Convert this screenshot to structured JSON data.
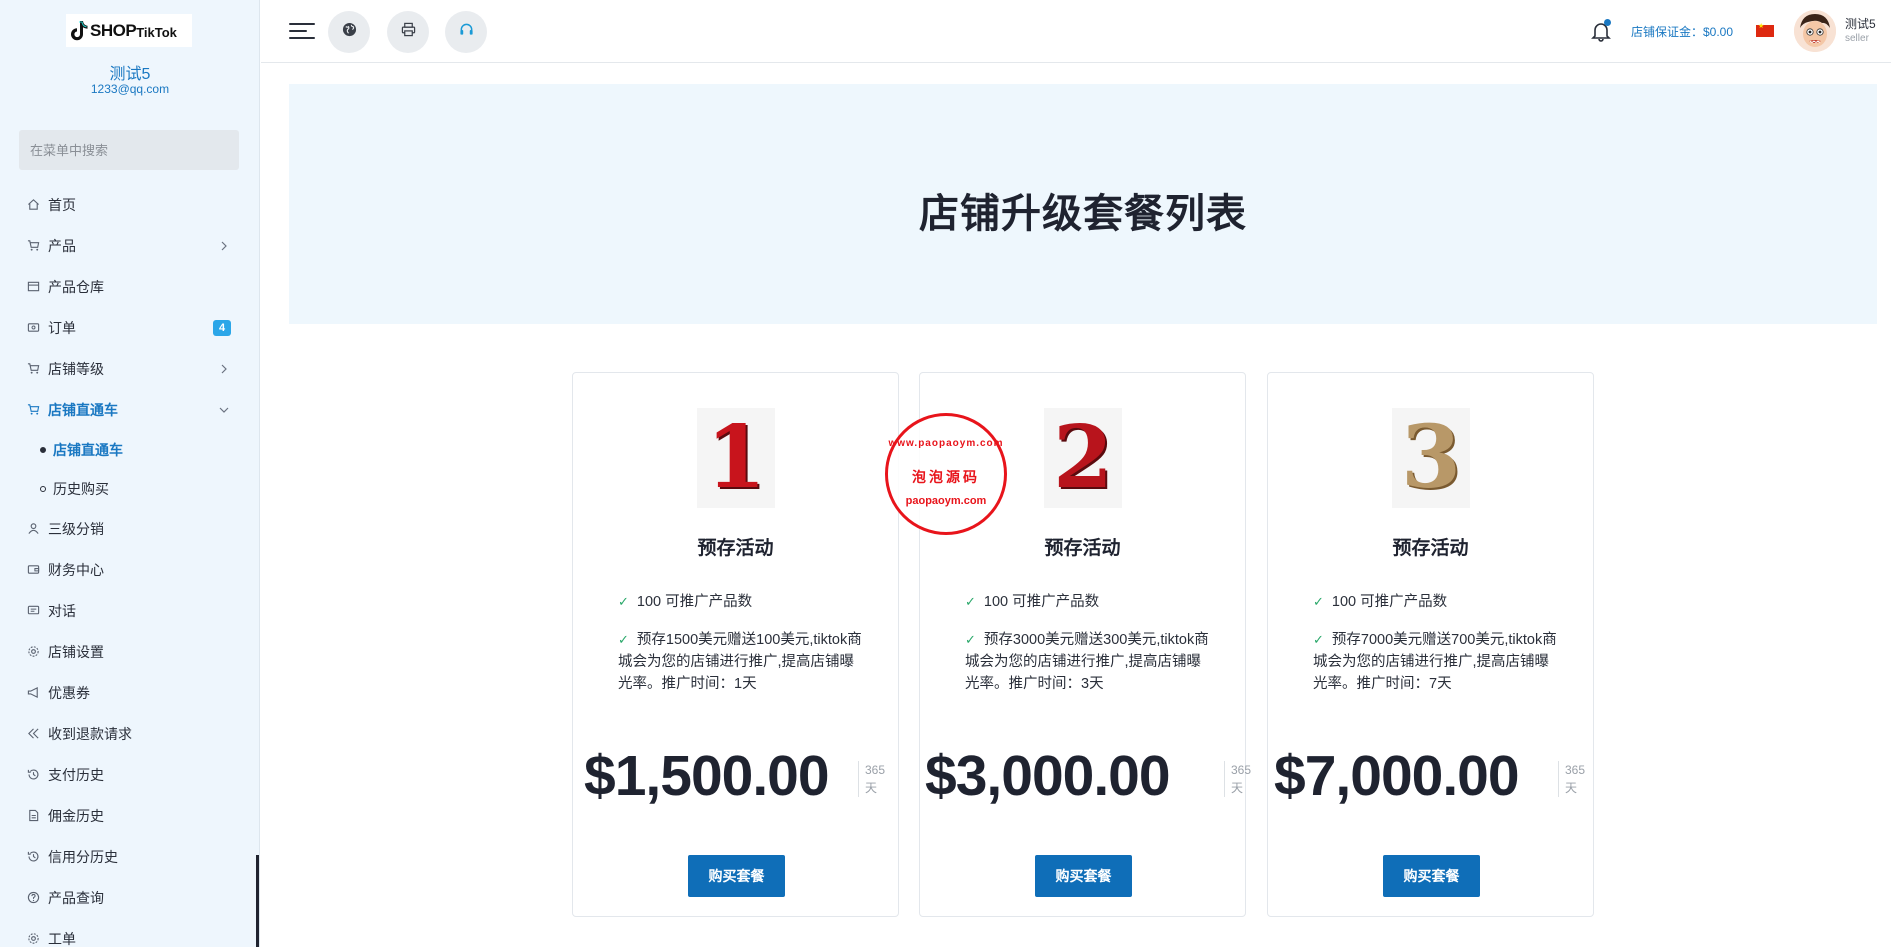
{
  "sidebar": {
    "brand_main": "SHOP",
    "brand_sub": "TikTok",
    "shop_name": "测试5",
    "shop_email": "1233@qq.com",
    "search_placeholder": "在菜单中搜索",
    "items": [
      {
        "label": "首页",
        "icon": "home-icon"
      },
      {
        "label": "产品",
        "icon": "cart-icon",
        "has_children": true
      },
      {
        "label": "产品仓库",
        "icon": "box-icon"
      },
      {
        "label": "订单",
        "icon": "order-icon",
        "badge": "4"
      },
      {
        "label": "店铺等级",
        "icon": "cart-icon",
        "has_children": true
      },
      {
        "label": "店铺直通车",
        "icon": "cart-icon",
        "has_children": true,
        "expanded": true,
        "active": true
      },
      {
        "label": "店铺直通车",
        "sub": true,
        "active": true
      },
      {
        "label": "历史购买",
        "sub": true
      },
      {
        "label": "三级分销",
        "icon": "user-icon"
      },
      {
        "label": "财务中心",
        "icon": "wallet-icon"
      },
      {
        "label": "对话",
        "icon": "chat-icon"
      },
      {
        "label": "店铺设置",
        "icon": "gear-icon"
      },
      {
        "label": "优惠券",
        "icon": "megaphone-icon"
      },
      {
        "label": "收到退款请求",
        "icon": "refund-icon"
      },
      {
        "label": "支付历史",
        "icon": "history-icon"
      },
      {
        "label": "佣金历史",
        "icon": "document-icon"
      },
      {
        "label": "信用分历史",
        "icon": "history-icon"
      },
      {
        "label": "产品查询",
        "icon": "question-icon"
      },
      {
        "label": "工单",
        "icon": "gear-icon"
      }
    ]
  },
  "header": {
    "deposit_label": "店铺保证金：$0.00",
    "user_name": "测试5",
    "user_role": "seller"
  },
  "page": {
    "title": "店铺升级套餐列表"
  },
  "plans": [
    {
      "rank": "1",
      "rank_color": "#c8141c",
      "title": "预存活动",
      "feature_1": "100 可推广产品数",
      "feature_2": "预存1500美元赠送100美元,tiktok商城会为您的店铺进行推广,提高店铺曝光率。推广时间：1天",
      "price": "$1,500.00",
      "period_value": "365",
      "period_unit": "天",
      "button": "购买套餐"
    },
    {
      "rank": "2",
      "rank_color": "#b8141c",
      "title": "预存活动",
      "feature_1": "100 可推广产品数",
      "feature_2": "预存3000美元赠送300美元,tiktok商城会为您的店铺进行推广,提高店铺曝光率。推广时间：3天",
      "price": "$3,000.00",
      "period_value": "365",
      "period_unit": "天",
      "button": "购买套餐"
    },
    {
      "rank": "3",
      "rank_color": "#b89868",
      "title": "预存活动",
      "feature_1": "100 可推广产品数",
      "feature_2": "预存7000美元赠送700美元,tiktok商城会为您的店铺进行推广,提高店铺曝光率。推广时间：7天",
      "price": "$7,000.00",
      "period_value": "365",
      "period_unit": "天",
      "button": "购买套餐"
    }
  ],
  "watermark": {
    "top": "www.paopaoym.com",
    "middle": "泡泡源码",
    "bottom": "paopaoym.com"
  }
}
